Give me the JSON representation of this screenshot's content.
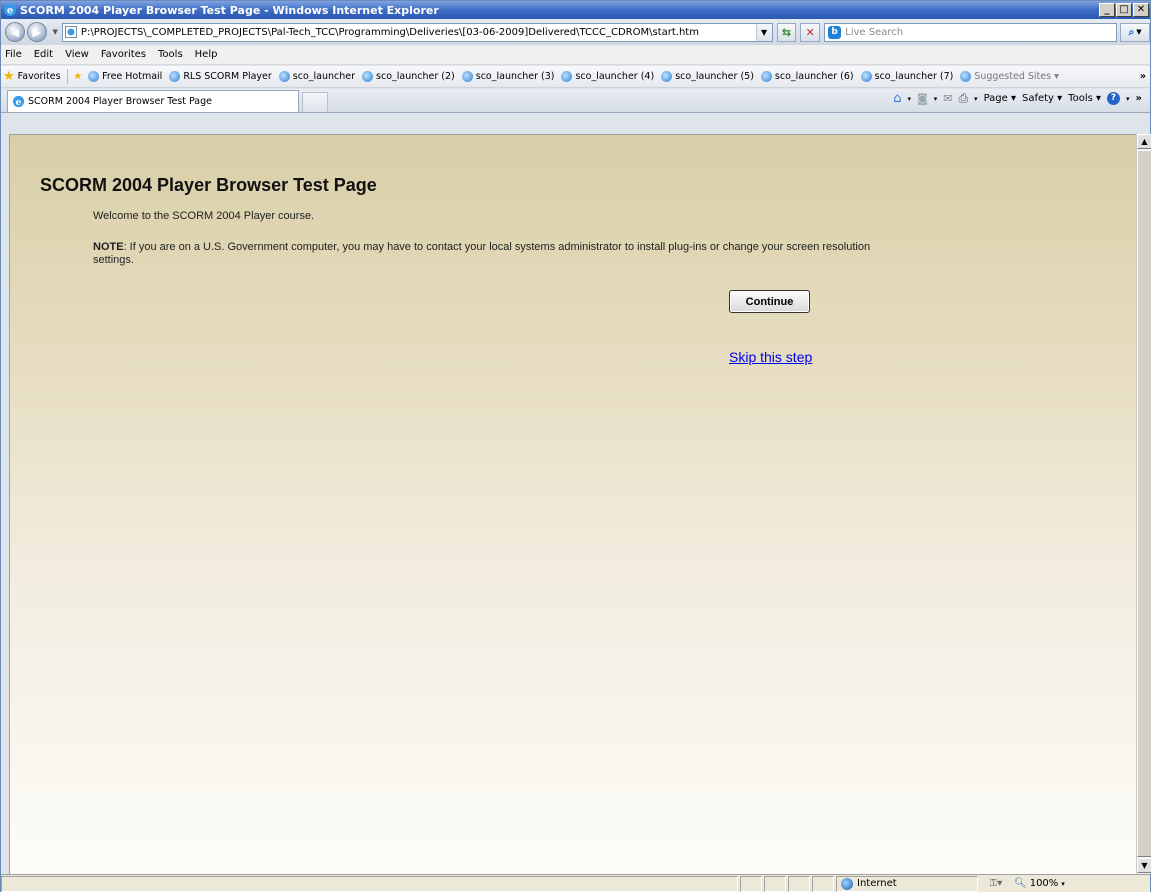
{
  "window": {
    "title": "SCORM 2004 Player Browser Test Page - Windows Internet Explorer",
    "min": "_",
    "max": "□",
    "close": "✕"
  },
  "address": {
    "url": "P:\\PROJECTS\\_COMPLETED_PROJECTS\\Pal-Tech_TCC\\Programming\\Deliveries\\[03-06-2009]Delivered\\TCCC_CDROM\\start.htm",
    "search_placeholder": "Live Search"
  },
  "menu": [
    "File",
    "Edit",
    "View",
    "Favorites",
    "Tools",
    "Help"
  ],
  "favorites": {
    "label": "Favorites",
    "items": [
      "Free Hotmail",
      "RLS SCORM Player",
      "sco_launcher",
      "sco_launcher (2)",
      "sco_launcher (3)",
      "sco_launcher (4)",
      "sco_launcher (5)",
      "sco_launcher (6)",
      "sco_launcher (7)",
      "Suggested Sites ▾"
    ],
    "more": "»"
  },
  "tab": {
    "title": "SCORM 2004 Player Browser Test Page"
  },
  "commands": {
    "page": "Page ▾",
    "safety": "Safety ▾",
    "tools": "Tools ▾",
    "more": "»"
  },
  "page": {
    "heading": "SCORM 2004 Player Browser Test Page",
    "welcome": "Welcome to the SCORM 2004 Player course.",
    "note_label": "NOTE",
    "note_text": ": If you are on a U.S. Government computer, you may have to contact your local systems administrator to install plug-ins or change your screen resolution settings.",
    "continue_button": "Continue",
    "skip_link": "Skip this step"
  },
  "status": {
    "zone": "Internet",
    "zoom": "100%"
  }
}
